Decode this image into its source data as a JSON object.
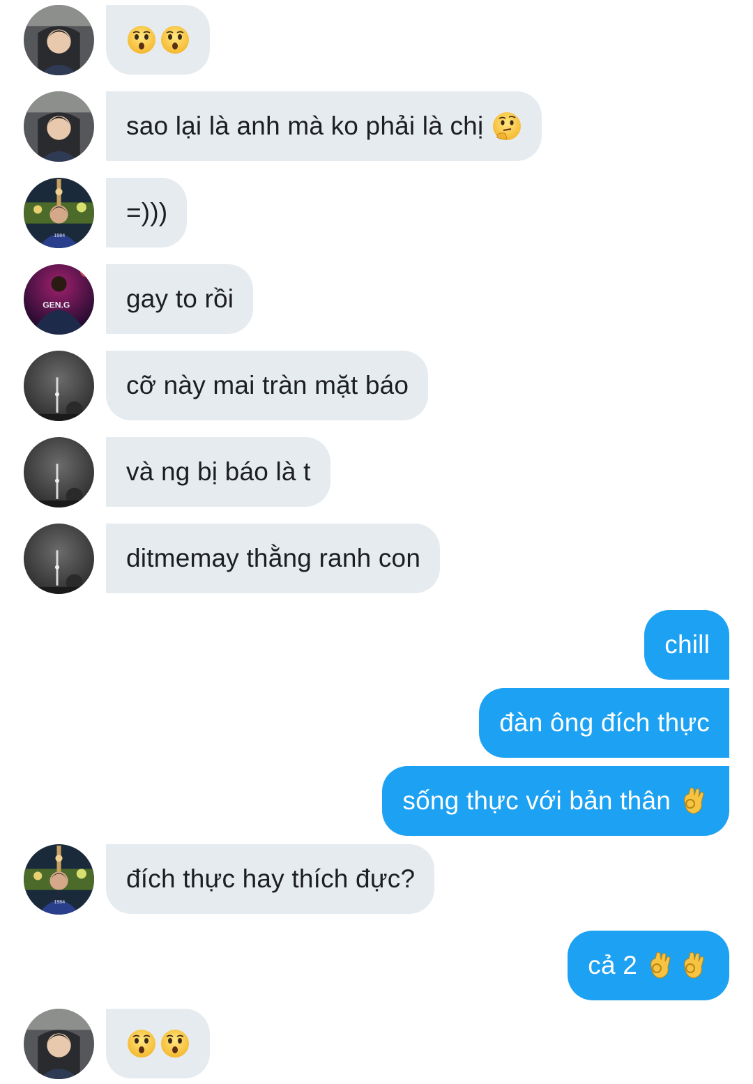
{
  "messages": [
    {
      "id": "m1",
      "side": "in",
      "text": "",
      "emojis": [
        "hushed-face-icon",
        "hushed-face-icon"
      ],
      "avatar": "avatar-gaming-chair"
    },
    {
      "id": "m2",
      "side": "in",
      "text": "sao lại là anh mà ko phải là chị",
      "emojis": [
        "thinking-face-icon"
      ],
      "avatar": "avatar-gaming-chair"
    },
    {
      "id": "m3",
      "side": "in",
      "text": "=)))",
      "emojis": [],
      "avatar": "avatar-city-night"
    },
    {
      "id": "m4",
      "side": "in",
      "text": "gay to rồi",
      "emojis": [],
      "avatar": "avatar-geng-jacket"
    },
    {
      "id": "m5",
      "side": "in",
      "text": "cỡ này mai tràn mặt báo",
      "emojis": [],
      "avatar": "avatar-tower-dark"
    },
    {
      "id": "m6",
      "side": "in",
      "text": "và ng bị báo là t",
      "emojis": [],
      "avatar": "avatar-tower-dark"
    },
    {
      "id": "m7",
      "side": "in",
      "text": "ditmemay thằng ranh con",
      "emojis": [],
      "avatar": "avatar-tower-dark"
    },
    {
      "id": "m8",
      "side": "out",
      "text": "chill",
      "emojis": []
    },
    {
      "id": "m9",
      "side": "out",
      "text": "đàn ông đích thực",
      "emojis": []
    },
    {
      "id": "m10",
      "side": "out",
      "text": "sống thực với bản thân",
      "emojis": [
        "ok-hand-icon"
      ]
    },
    {
      "id": "m11",
      "side": "in",
      "text": "đích thực hay thích đực?",
      "emojis": [],
      "avatar": "avatar-city-night"
    },
    {
      "id": "m12",
      "side": "out",
      "text": "cả 2",
      "emojis": [
        "ok-hand-icon",
        "ok-hand-icon"
      ]
    },
    {
      "id": "m13",
      "side": "in",
      "text": "",
      "emojis": [
        "hushed-face-icon",
        "hushed-face-icon"
      ],
      "avatar": "avatar-gaming-chair"
    }
  ],
  "colors": {
    "incoming_bubble": "#e6ebef",
    "outgoing_bubble": "#1da1f2",
    "incoming_text": "#1c1e21",
    "outgoing_text": "#ffffff"
  }
}
